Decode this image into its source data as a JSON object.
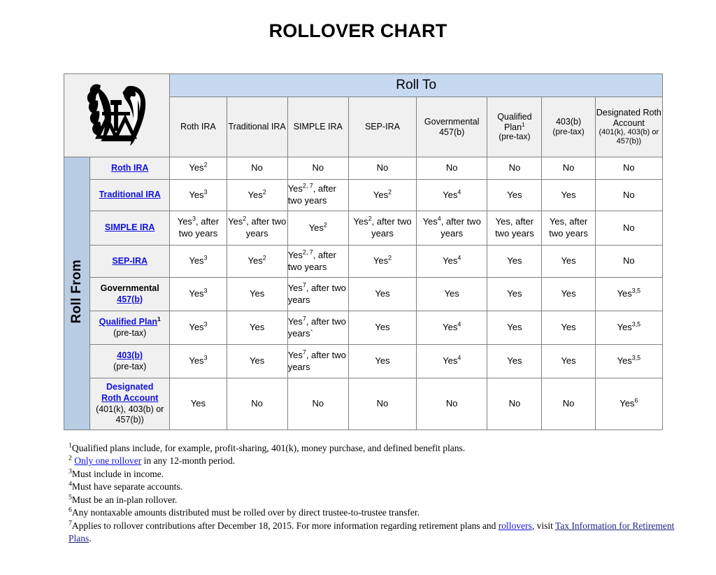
{
  "title": "ROLLOVER CHART",
  "logo": {
    "icon": "irs-eagle-scales-logo",
    "alt": "IRS logo"
  },
  "table": {
    "roll_to_label": "Roll To",
    "roll_from_label": "Roll From",
    "columns": [
      {
        "key": "roth_ira",
        "label": "Roth IRA",
        "sub": ""
      },
      {
        "key": "traditional_ira",
        "label": "Traditional IRA",
        "sub": ""
      },
      {
        "key": "simple_ira",
        "label": "SIMPLE IRA",
        "sub": ""
      },
      {
        "key": "sep_ira",
        "label": "SEP-IRA",
        "sub": ""
      },
      {
        "key": "governmental_457b",
        "label": "Governmental 457(b)",
        "sub": ""
      },
      {
        "key": "qualified_plan",
        "label": "Qualified Plan",
        "sup": "1",
        "sub": "(pre-tax)"
      },
      {
        "key": "403b",
        "label": "403(b)",
        "sub": "(pre-tax)"
      },
      {
        "key": "designated_roth",
        "label": "Designated Roth Account",
        "small": "(401(k), 403(b) or 457(b))"
      }
    ],
    "rows": [
      {
        "label": "Roth IRA",
        "label_link": true,
        "cells": [
          {
            "text": "Yes",
            "sup": "2"
          },
          {
            "text": "No"
          },
          {
            "text": "No"
          },
          {
            "text": "No"
          },
          {
            "text": "No"
          },
          {
            "text": "No"
          },
          {
            "text": "No"
          },
          {
            "text": "No"
          }
        ]
      },
      {
        "label": "Traditional IRA",
        "label_link": true,
        "cells": [
          {
            "text": "Yes",
            "sup": "3"
          },
          {
            "text": "Yes",
            "sup": "2"
          },
          {
            "text": "Yes",
            "sup": "2, 7",
            "tail": ", after two years",
            "wrap": true
          },
          {
            "text": "Yes",
            "sup": "2"
          },
          {
            "text": "Yes",
            "sup": "4"
          },
          {
            "text": "Yes"
          },
          {
            "text": "Yes"
          },
          {
            "text": "No"
          }
        ]
      },
      {
        "label": "SIMPLE IRA",
        "label_link": true,
        "cells": [
          {
            "text": "Yes",
            "sup": "3",
            "tail": ", after two years"
          },
          {
            "text": "Yes",
            "sup": "2",
            "tail": ", after two years"
          },
          {
            "text": "Yes",
            "sup": "2"
          },
          {
            "text": "Yes",
            "sup": "2",
            "tail": ", after two years"
          },
          {
            "text": "Yes",
            "sup": "4",
            "tail": ", after two years"
          },
          {
            "text": "Yes, after two years"
          },
          {
            "text": "Yes, after two years"
          },
          {
            "text": "No"
          }
        ]
      },
      {
        "label": "SEP-IRA",
        "label_link": true,
        "cells": [
          {
            "text": "Yes",
            "sup": "3"
          },
          {
            "text": "Yes",
            "sup": "2"
          },
          {
            "text": "Yes",
            "sup": "2, 7",
            "tail": ", after two years",
            "wrap": true
          },
          {
            "text": "Yes",
            "sup": "2"
          },
          {
            "text": "Yes",
            "sup": "4"
          },
          {
            "text": "Yes"
          },
          {
            "text": "Yes"
          },
          {
            "text": "No"
          }
        ]
      },
      {
        "label": "Governmental 457(b)",
        "label_black_part": "Governmental",
        "label_link_part": "457(b)",
        "cells": [
          {
            "text": "Yes",
            "sup": "3"
          },
          {
            "text": "Yes"
          },
          {
            "text": "Yes",
            "sup": "7",
            "tail": ", after two years",
            "wrap": true
          },
          {
            "text": "Yes"
          },
          {
            "text": "Yes"
          },
          {
            "text": "Yes"
          },
          {
            "text": "Yes"
          },
          {
            "text": "Yes",
            "sup": "3,5"
          }
        ]
      },
      {
        "label": "Qualified Plan",
        "label_link": true,
        "label_sup": "1",
        "label_sub": "(pre-tax)",
        "cells": [
          {
            "text": "Yes",
            "sup": "3"
          },
          {
            "text": "Yes"
          },
          {
            "text": "Yes",
            "sup": "7",
            "tail": ", after two years`",
            "wrap": true
          },
          {
            "text": "Yes"
          },
          {
            "text": "Yes",
            "sup": "4"
          },
          {
            "text": "Yes"
          },
          {
            "text": "Yes"
          },
          {
            "text": "Yes",
            "sup": "3,5"
          }
        ]
      },
      {
        "label": "403(b)",
        "label_link": true,
        "label_sub": "(pre-tax)",
        "cells": [
          {
            "text": "Yes",
            "sup": "3"
          },
          {
            "text": "Yes"
          },
          {
            "text": "Yes",
            "sup": "7",
            "tail": ", after two years",
            "wrap": true
          },
          {
            "text": "Yes"
          },
          {
            "text": "Yes",
            "sup": "4"
          },
          {
            "text": "Yes"
          },
          {
            "text": "Yes"
          },
          {
            "text": "Yes",
            "sup": "3,5"
          }
        ]
      },
      {
        "label": "Designated Roth Account",
        "label_blue_plain": "Designated",
        "label_link_part": "Roth Account",
        "label_sub": "(401(k), 403(b) or 457(b))",
        "cells": [
          {
            "text": "Yes"
          },
          {
            "text": "No"
          },
          {
            "text": "No"
          },
          {
            "text": "No"
          },
          {
            "text": "No"
          },
          {
            "text": "No"
          },
          {
            "text": "No"
          },
          {
            "text": "Yes",
            "sup": "6"
          }
        ]
      }
    ]
  },
  "footnotes": [
    {
      "num": "1",
      "text": "Qualified plans include, for example, profit-sharing, 401(k), money purchase, and defined benefit plans."
    },
    {
      "num": "2",
      "pre": " ",
      "link": "Only one rollover",
      "post": " in any 12-month period."
    },
    {
      "num": "3",
      "text": "Must include in income."
    },
    {
      "num": "4",
      "text": "Must have separate accounts."
    },
    {
      "num": "5",
      "text": "Must be an in-plan rollover."
    },
    {
      "num": "6",
      "text": "Any nontaxable amounts distributed must be rolled over by direct trustee-to-trustee transfer."
    },
    {
      "num": "7",
      "pre": "Applies to rollover contributions after December 18, 2015. For more information regarding retirement plans and ",
      "link": "rollovers",
      "mid": ", visit ",
      "link2": "Tax Information for Retirement Plans",
      "post": "."
    }
  ],
  "colors": {
    "roll_to_band": "#c6d9f0",
    "roll_from_band": "#b8cce4",
    "header_fill": "#f0f0f0",
    "link": "#1111dd",
    "border": "#808080"
  }
}
